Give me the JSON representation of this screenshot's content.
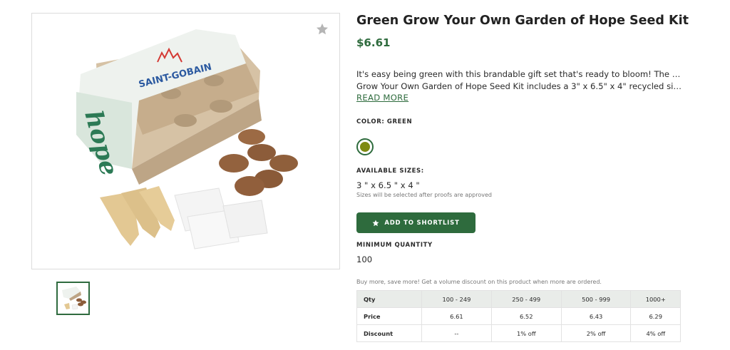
{
  "product": {
    "title": "Green Grow Your Own Garden of Hope Seed Kit",
    "price": "$6.61",
    "description_line1": "It's easy being green with this brandable gift set that's ready to bloom! The Green",
    "description_line2": "Grow Your Own Garden of Hope Seed Kit includes a 3\" x 6.5\" x 4\" recycled six-secti…",
    "read_more": "READ MORE",
    "image_logo_text": "SAINT-GOBAIN",
    "image_sleeve_text": "hope"
  },
  "color": {
    "label": "COLOR: GREEN",
    "swatch_color": "#7e8a12"
  },
  "sizes": {
    "label": "AVAILABLE SIZES:",
    "value": "3 \" x 6.5 \" x 4 \"",
    "note": "Sizes will be selected after proofs are approved"
  },
  "shortlist": {
    "label": "ADD TO SHORTLIST",
    "icon": "star-icon"
  },
  "minimum": {
    "label": "MINIMUM QUANTITY",
    "value": "100"
  },
  "volume_note": "Buy more, save more! Get a volume discount on this product when more are ordered.",
  "pricing_table": {
    "header": [
      "Qty",
      "100 - 249",
      "250 - 499",
      "500 - 999",
      "1000+"
    ],
    "price_row": [
      "Price",
      "6.61",
      "6.52",
      "6.43",
      "6.29"
    ],
    "discount_row": [
      "Discount",
      "--",
      "1% off",
      "2% off",
      "4% off"
    ]
  },
  "colors": {
    "brand_green": "#2e6b3d",
    "table_header_bg": "#e9ece9"
  }
}
